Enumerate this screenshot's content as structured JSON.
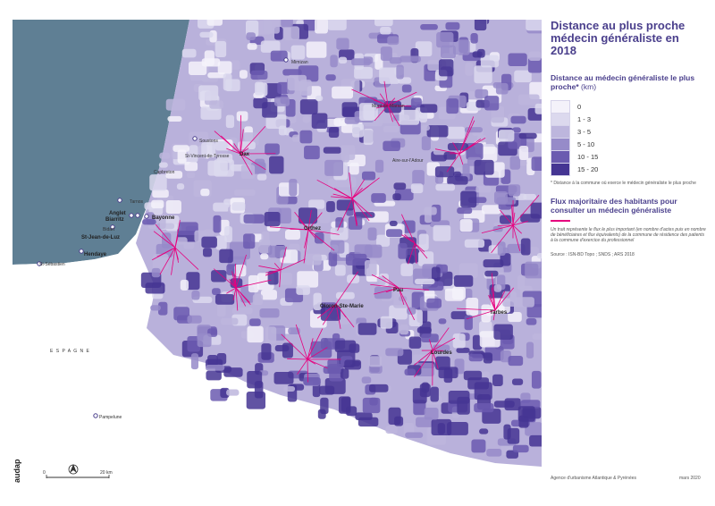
{
  "title": "Distance au plus proche médecin généraliste en 2018",
  "legend": {
    "title": "Distance au médecin généraliste le plus proche*",
    "unit": "(km)",
    "classes": [
      {
        "label": "0",
        "color": "#f4f2fa"
      },
      {
        "label": "1 - 3",
        "color": "#dcd9ee"
      },
      {
        "label": "3 - 5",
        "color": "#bdb6dd"
      },
      {
        "label": "5 - 10",
        "color": "#968bc9"
      },
      {
        "label": "10 - 15",
        "color": "#6b5bb0"
      },
      {
        "label": "15 - 20",
        "color": "#453593"
      }
    ],
    "footnote": "* Distance à la commune où exerce le médecin généraliste le plus proche"
  },
  "flux": {
    "title": "Flux majoritaire des habitants pour consulter un médecin généraliste",
    "color": "#e6007e",
    "note": "Un trait représente le flux le plus important (en nombre d'actes puis en nombre de bénéficiaires et flux équivalents) de la commune de résidence des patients à la commune d'exercice du professionnel"
  },
  "source": "Source : ISN-BD Topo ; SNDS ; ARS 2018",
  "credit": "Agence d'urbanisme Atlantique & Pyrénées",
  "date": "mars 2020",
  "logo": "audap",
  "map": {
    "sea_color": "#5f7f94",
    "spain_label": "E S P A G N E",
    "scale_start": "0",
    "scale_end": "20 km",
    "places": [
      {
        "name": "Mimizan",
        "style": "normal"
      },
      {
        "name": "Mont-de-Marsan",
        "style": "normal"
      },
      {
        "name": "Dax",
        "style": "normal"
      },
      {
        "name": "Soustons",
        "style": "normal"
      },
      {
        "name": "St-Vincent-de-Tyrosse",
        "style": "normal"
      },
      {
        "name": "Capbreton",
        "style": "normal"
      },
      {
        "name": "Tarnos",
        "style": "normal"
      },
      {
        "name": "Anglet",
        "style": "bold"
      },
      {
        "name": "Biarritz",
        "style": "bold"
      },
      {
        "name": "Bayonne",
        "style": "bold"
      },
      {
        "name": "Bidart",
        "style": "normal"
      },
      {
        "name": "St-Jean-de-Luz",
        "style": "bold"
      },
      {
        "name": "Hendaye",
        "style": "bold"
      },
      {
        "name": "St-Sébastien",
        "style": "normal"
      },
      {
        "name": "Orthez",
        "style": "normal"
      },
      {
        "name": "Pau",
        "style": "normal"
      },
      {
        "name": "Oloron-Ste-Marie",
        "style": "normal"
      },
      {
        "name": "Tarbes",
        "style": "normal"
      },
      {
        "name": "Lourdes",
        "style": "normal"
      },
      {
        "name": "Aire-sur-l'Adour",
        "style": "normal"
      },
      {
        "name": "Pampelune",
        "style": "normal"
      }
    ]
  }
}
